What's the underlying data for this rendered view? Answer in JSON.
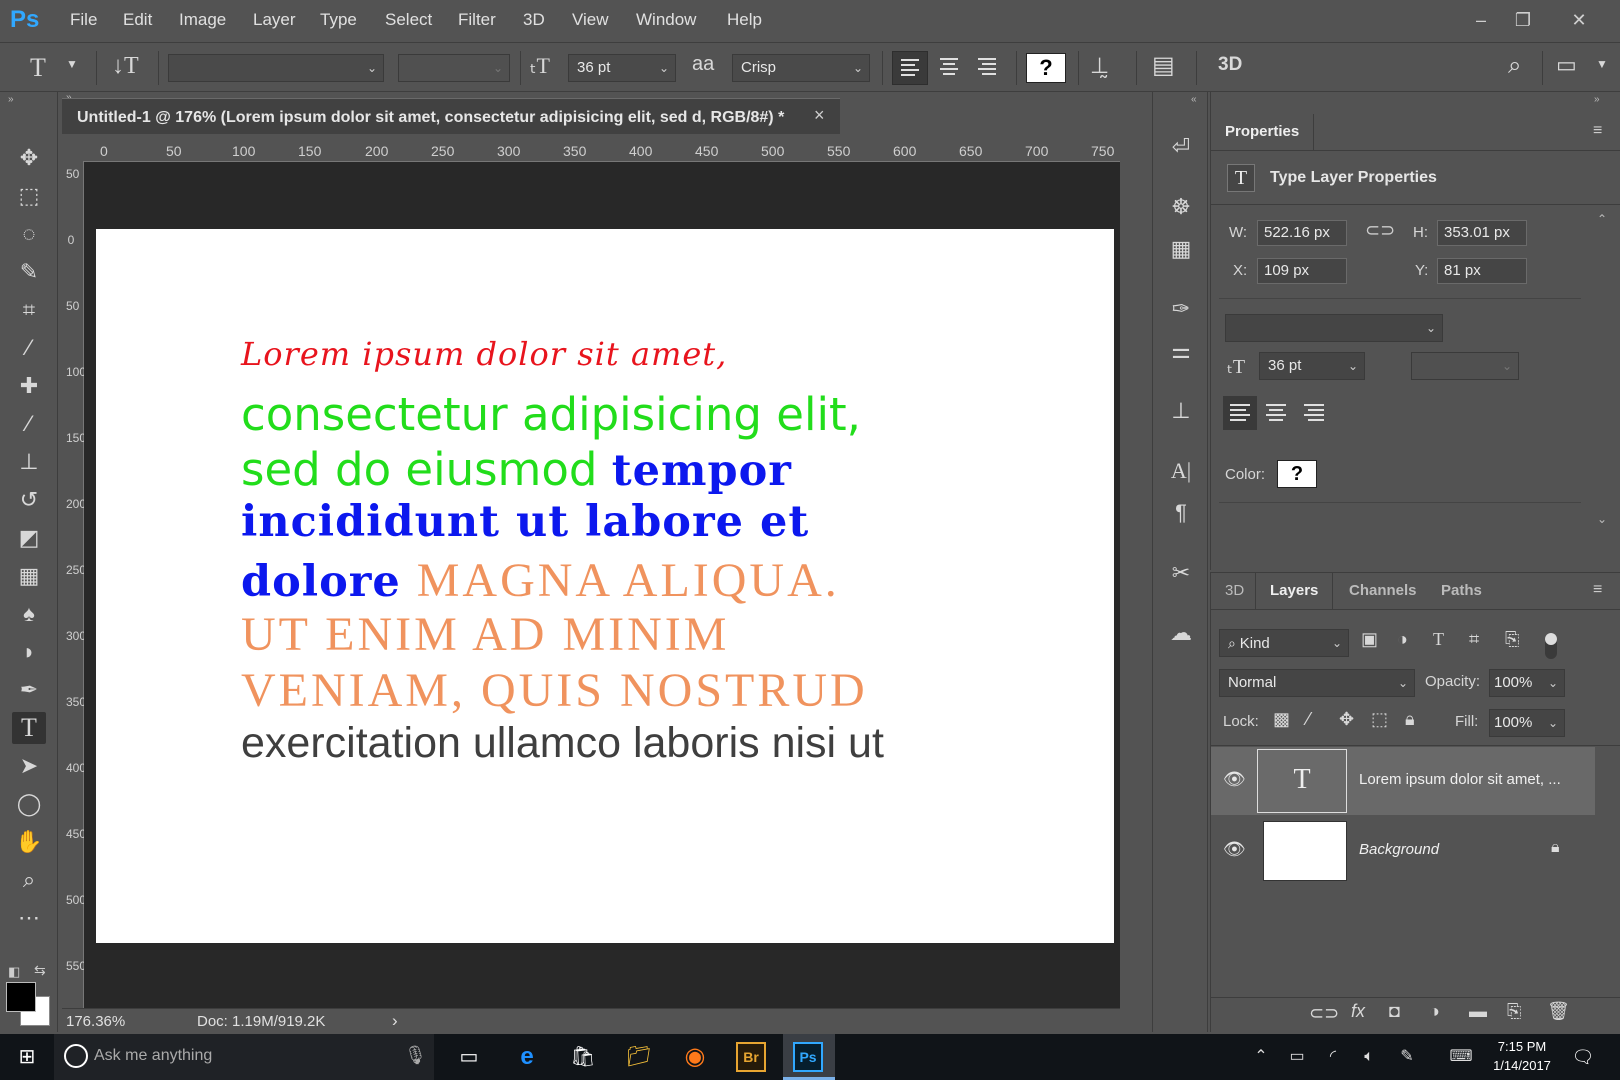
{
  "app": {
    "logo": "Ps"
  },
  "menu": [
    "File",
    "Edit",
    "Image",
    "Layer",
    "Type",
    "Select",
    "Filter",
    "3D",
    "View",
    "Window",
    "Help"
  ],
  "window_buttons": [
    "–",
    "❐",
    "✕"
  ],
  "options": {
    "font_family": "",
    "font_style": "",
    "font_size": "36 pt",
    "antialias_icon": "aa",
    "antialias": "Crisp",
    "color_swatch": "?",
    "threed": "3D"
  },
  "document": {
    "tab_title": "Untitled-1 @ 176% (Lorem ipsum dolor sit amet, consectetur adipisicing elit, sed d, RGB/8#) *",
    "close": "×",
    "ruler_h": [
      "0",
      "50",
      "100",
      "150",
      "200",
      "250",
      "300",
      "350",
      "400",
      "450",
      "500",
      "550",
      "600",
      "650",
      "700",
      "750"
    ],
    "ruler_v": [
      "50",
      "0",
      "50",
      "100",
      "150",
      "200",
      "250",
      "300",
      "350",
      "400",
      "450",
      "500",
      "550"
    ],
    "text_lines": [
      {
        "parts": [
          {
            "text": "Lorem ipsum dolor sit amet,",
            "color": "#e8141d"
          }
        ]
      },
      {
        "parts": [
          {
            "text": "consectetur adipisicing elit,",
            "color": "#22dd1b"
          }
        ]
      },
      {
        "parts": [
          {
            "text": "sed do eiusmod ",
            "color": "#22dd1b"
          },
          {
            "text": "tempor",
            "color": "#0c18ee"
          }
        ]
      },
      {
        "parts": [
          {
            "text": "incididunt ut labore et",
            "color": "#0c18ee"
          }
        ]
      },
      {
        "parts": [
          {
            "text": "dolore ",
            "color": "#0c18ee"
          },
          {
            "text": "MAGNA ALIQUA.",
            "color": "#f0935e"
          }
        ]
      },
      {
        "parts": [
          {
            "text": "UT ENIM AD MINIM",
            "color": "#f0935e"
          }
        ]
      },
      {
        "parts": [
          {
            "text": "VENIAM, QUIS NOSTRUD",
            "color": "#f0935e"
          }
        ]
      },
      {
        "parts": [
          {
            "text": "exercitation ullamco laboris nisi ut",
            "color": "#3f3f3f"
          }
        ]
      }
    ]
  },
  "status": {
    "zoom": "176.36%",
    "doc": "Doc: 1.19M/919.2K",
    "arrow": "›"
  },
  "properties": {
    "tab": "Properties",
    "section": "Type Layer Properties",
    "w_label": "W:",
    "w": "522.16 px",
    "h_label": "H:",
    "h": "353.01 px",
    "x_label": "X:",
    "x": "109 px",
    "y_label": "Y:",
    "y": "81 px",
    "font_size": "36 pt",
    "color_label": "Color:",
    "color_swatch": "?"
  },
  "layers_panel": {
    "tabs": [
      "3D",
      "Layers",
      "Channels",
      "Paths"
    ],
    "active_tab": "Layers",
    "kind": "Kind",
    "blend": "Normal",
    "opacity_label": "Opacity:",
    "opacity": "100%",
    "lock_label": "Lock:",
    "fill_label": "Fill:",
    "fill": "100%",
    "layers": [
      {
        "name": "Lorem ipsum dolor sit amet, ...",
        "thumb": "T"
      },
      {
        "name": "Background",
        "thumb": ""
      }
    ]
  },
  "taskbar": {
    "search_placeholder": "Ask me anything",
    "time": "7:15 PM",
    "date": "1/14/2017",
    "br": "Br",
    "ps": "Ps"
  }
}
